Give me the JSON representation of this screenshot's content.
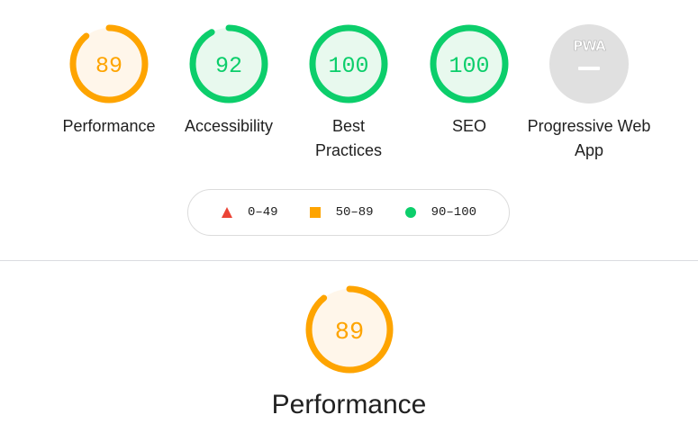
{
  "colors": {
    "fail": "#eb4436",
    "average": "#fea400",
    "pass": "#0cce6b",
    "average_bg": "#fff6ea",
    "pass_bg": "#e8f9ee",
    "na_bg": "#e0e0e0"
  },
  "categories": [
    {
      "label": "Performance",
      "score": 89,
      "score_text": "89",
      "rating": "average"
    },
    {
      "label": "Accessibility",
      "score": 92,
      "score_text": "92",
      "rating": "pass"
    },
    {
      "label": "Best Practices",
      "score": 100,
      "score_text": "100",
      "rating": "pass"
    },
    {
      "label": "SEO",
      "score": 100,
      "score_text": "100",
      "rating": "pass"
    },
    {
      "label": "Progressive Web App",
      "score": null,
      "score_text": "",
      "rating": "na",
      "badge_text": "PWA",
      "icon": "pwa-badge-icon"
    }
  ],
  "legend": {
    "fail": {
      "range": "0–49",
      "shape": "triangle"
    },
    "average": {
      "range": "50–89",
      "shape": "square"
    },
    "pass": {
      "range": "90–100",
      "shape": "circle"
    }
  },
  "featured": {
    "label": "Performance",
    "score": 89,
    "score_text": "89",
    "rating": "average"
  }
}
